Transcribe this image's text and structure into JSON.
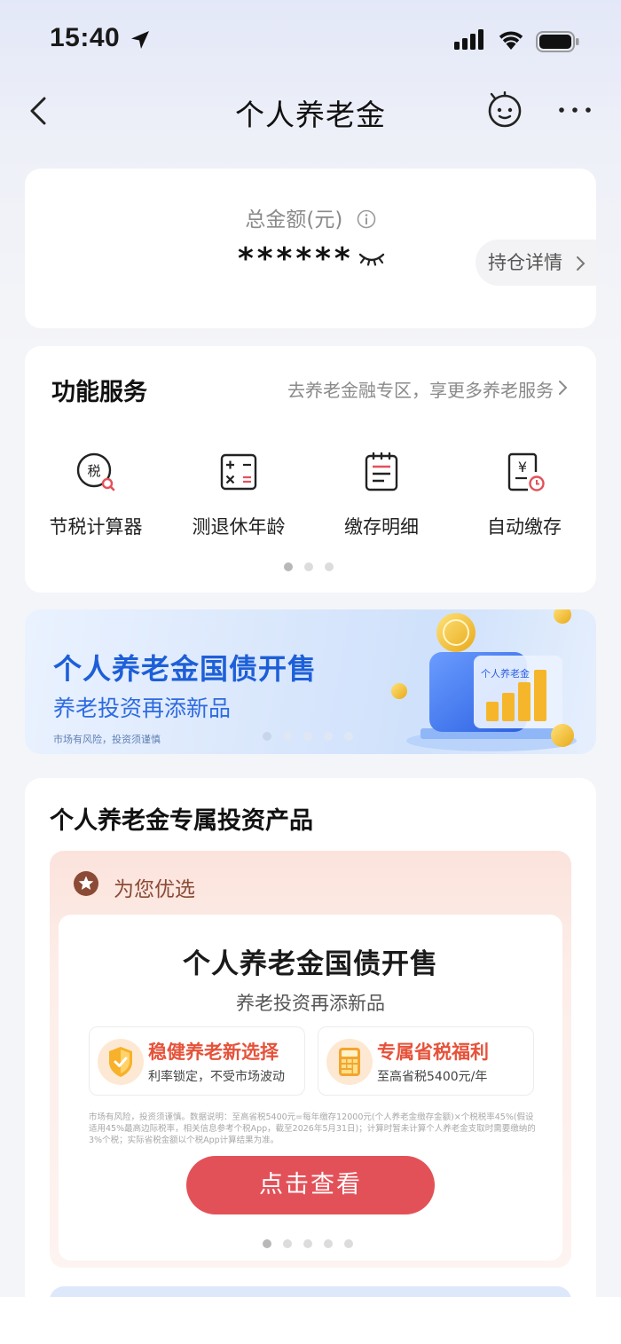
{
  "status_bar": {
    "time": "15:40"
  },
  "nav": {
    "title": "个人养老金",
    "icons": [
      "back-icon",
      "robot-icon",
      "more-icon"
    ]
  },
  "total": {
    "label": "总金额(元)",
    "value": "******",
    "hold_detail": "持仓详情"
  },
  "services": {
    "title": "功能服务",
    "link": "去养老金融专区，享更多养老服务",
    "items": [
      {
        "label": "节税计算器",
        "icon": "tax-calculator-icon"
      },
      {
        "label": "测退休年龄",
        "icon": "calculator-icon"
      },
      {
        "label": "缴存明细",
        "icon": "notepad-icon"
      },
      {
        "label": "自动缴存",
        "icon": "auto-deposit-icon"
      }
    ],
    "page_count": 3,
    "active_page": 1
  },
  "banner": {
    "title": "个人养老金国债开售",
    "subtitle": "养老投资再添新品",
    "risk": "市场有风险，投资须谨慎",
    "art_label": "个人养老金",
    "page_count": 5,
    "active_page": 1
  },
  "products": {
    "title": "个人养老金专属投资产品",
    "pick_label": "为您优选",
    "card": {
      "title": "个人养老金国债开售",
      "subtitle": "养老投资再添新品",
      "features": [
        {
          "title": "稳健养老新选择",
          "desc": "利率锁定，不受市场波动"
        },
        {
          "title": "专属省税福利",
          "desc": "至高省税5400元/年"
        }
      ],
      "disclaimer": "市场有风险，投资须谨慎。数据说明：至高省税5400元=每年缴存12000元(个人养老金缴存金额)×个税税率45%(假设适用45%最高边际税率，相关信息参考个税App，截至2026年5月31日)；计算时暂未计算个人养老金支取时需要缴纳的3%个税；实际省税金额以个税App计算结果为准。",
      "cta": "点击查看",
      "page_count": 5,
      "active_page": 1
    }
  },
  "colors": {
    "accent_blue": "#1d5fd8",
    "cta_red": "#e35158",
    "feature_red": "#e6523a"
  }
}
